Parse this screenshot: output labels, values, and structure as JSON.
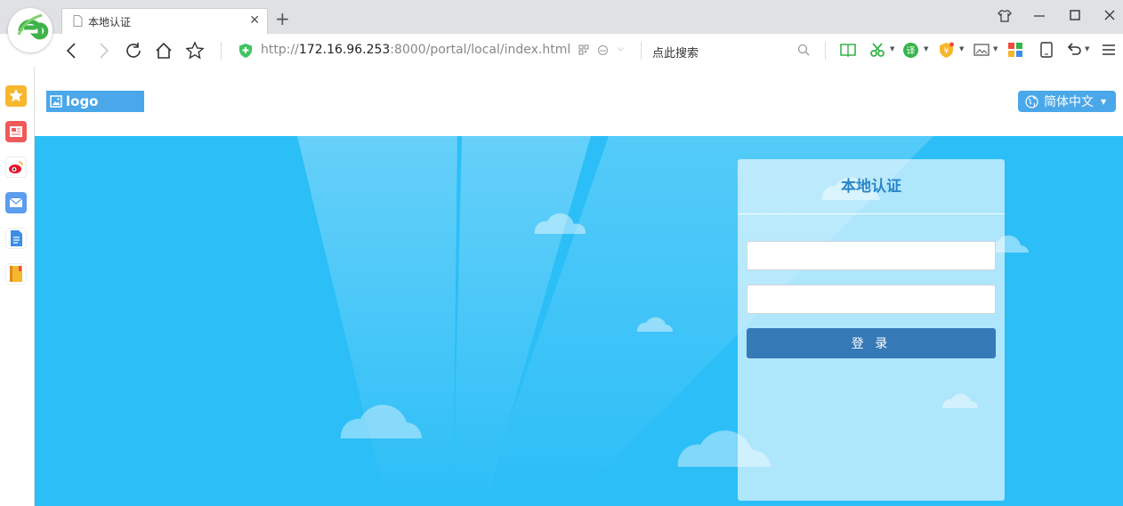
{
  "browser": {
    "tab_title": "本地认证",
    "url_prefix": "http://",
    "url_host": "172.16.96.253",
    "url_rest": ":8000/portal/local/index.html",
    "search_placeholder": "点此搜索",
    "accent_color": "#2bbef7"
  },
  "page": {
    "logo_text": "logo",
    "language_label": "简体中文",
    "panel_title": "本地认证",
    "username_value": "",
    "password_value": "",
    "login_label": "登 录",
    "button_color": "#3679b7"
  },
  "icons": {
    "sidebar": [
      "favorites-icon",
      "news-icon",
      "weibo-icon",
      "mail-icon",
      "document-icon",
      "notebook-icon"
    ],
    "toolbar": [
      "back-icon",
      "forward-icon",
      "reload-icon",
      "home-icon",
      "star-icon",
      "qr-icon",
      "compat-mode-icon",
      "search-icon",
      "reader-icon",
      "scissors-icon",
      "translate-icon",
      "money-icon",
      "image-icon",
      "apps-icon",
      "tablet-icon",
      "undo-icon",
      "menu-icon"
    ]
  }
}
